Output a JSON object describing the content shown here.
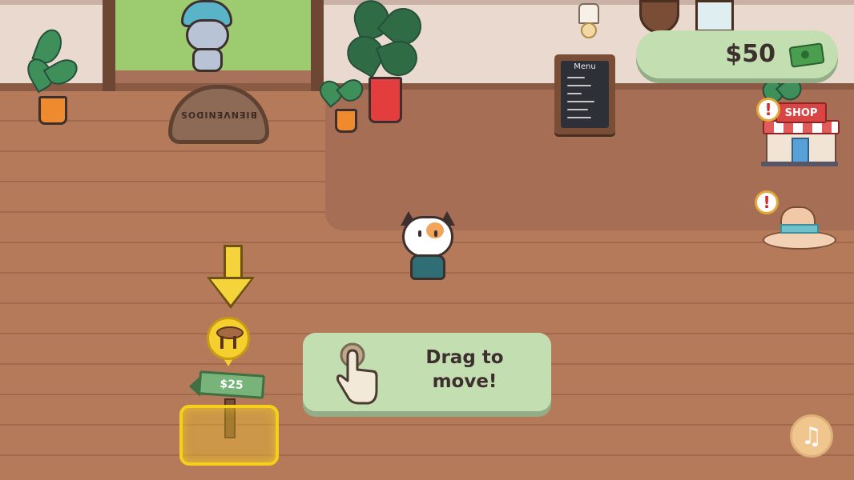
{
  "hud": {
    "money": "$50",
    "shop_label": "SHOP",
    "alert_mark": "!",
    "music_glyph": "♫"
  },
  "scene": {
    "doormat_text": "BIENVENIDOS",
    "menu_board_title": "Menu"
  },
  "build": {
    "price": "$25",
    "item_icon": "table-icon"
  },
  "tutorial": {
    "line1": "Drag to",
    "line2": "move!",
    "icon": "pointer-hand-icon"
  },
  "colors": {
    "panel_green": "#c3dfb2",
    "highlight_yellow": "#f6cf1a",
    "floor": "#b57a5a",
    "wall": "#ead9cf"
  }
}
